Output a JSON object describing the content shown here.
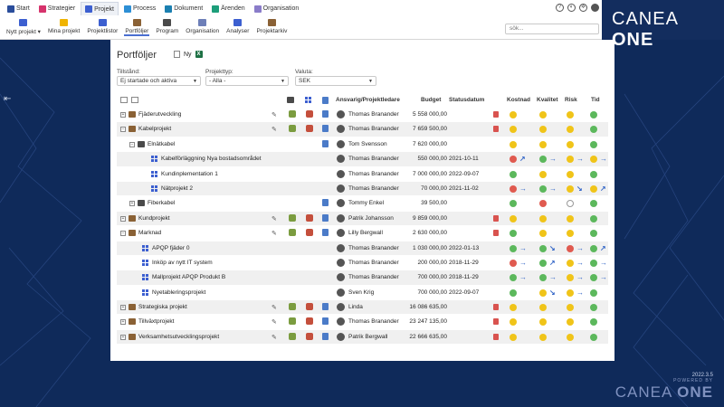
{
  "brand": {
    "name_a": "CANEA",
    "name_b": "ONE"
  },
  "modules": [
    {
      "label": "Start",
      "color": "#2a4d9b",
      "icon": "home-icon",
      "active": false
    },
    {
      "label": "Strategier",
      "color": "#d6336c",
      "icon": "strategy-icon",
      "active": false
    },
    {
      "label": "Projekt",
      "color": "#3c5fd0",
      "icon": "project-icon",
      "active": true
    },
    {
      "label": "Process",
      "color": "#2d8fd5",
      "icon": "process-icon",
      "active": false
    },
    {
      "label": "Dokument",
      "color": "#1b7fb0",
      "icon": "document-icon",
      "active": false
    },
    {
      "label": "Ärenden",
      "color": "#1d9e7a",
      "icon": "case-icon",
      "active": false
    },
    {
      "label": "Organisation",
      "color": "#8a7cc9",
      "icon": "organisation-icon",
      "active": false
    }
  ],
  "subnav": [
    {
      "label": "Nytt projekt ▾",
      "color": "#3c5fd0",
      "icon": "grid-icon"
    },
    {
      "label": "Mina projekt",
      "color": "#f0b400",
      "icon": "star-icon"
    },
    {
      "label": "Projektlistor",
      "color": "#3c5fd0",
      "icon": "list-icon"
    },
    {
      "label": "Portföljer",
      "color": "#8a6135",
      "icon": "portfolio-icon",
      "active": true
    },
    {
      "label": "Program",
      "color": "#4a4a4a",
      "icon": "program-icon"
    },
    {
      "label": "Organisation",
      "color": "#6d7fb8",
      "icon": "organisation-icon"
    },
    {
      "label": "Analyser",
      "color": "#3c5fd0",
      "icon": "chart-icon"
    },
    {
      "label": "Projektarkiv",
      "color": "#8a6135",
      "icon": "archive-icon"
    }
  ],
  "search": {
    "placeholder": "sök..."
  },
  "panel": {
    "title": "Portföljer",
    "new_label": "Ny",
    "filters": [
      {
        "label": "Tillstånd:",
        "value": "Ej startade och aktiva"
      },
      {
        "label": "Projekttyp:",
        "value": "- Alla -"
      },
      {
        "label": "Valuta:",
        "value": "SEK"
      }
    ],
    "columns": {
      "responsible": "Ansvarig/Projektledare",
      "budget": "Budget",
      "status_date": "Statusdatum",
      "cost": "Kostnad",
      "quality": "Kvalitet",
      "risk": "Risk",
      "time": "Tid"
    },
    "rows": [
      {
        "level": 0,
        "kind": "portfolio",
        "exp": "+",
        "name": "Fjäderutveckling",
        "pen": true,
        "puz": true,
        "book": true,
        "resp": "Thomas Branander",
        "budget": "5 558 000,00",
        "date": "",
        "trash": true,
        "s": [
          "y",
          "y",
          "y",
          "g"
        ],
        "a": [
          "",
          "",
          "",
          ""
        ]
      },
      {
        "level": 0,
        "kind": "portfolio",
        "exp": "−",
        "name": "Kabelprojekt",
        "pen": true,
        "puz": true,
        "book": true,
        "resp": "Thomas Branander",
        "budget": "7 659 500,00",
        "date": "",
        "trash": true,
        "s": [
          "y",
          "y",
          "y",
          "g"
        ],
        "a": [
          "",
          "",
          "",
          ""
        ]
      },
      {
        "level": 1,
        "kind": "program",
        "exp": "−",
        "name": "Elnätkabel",
        "pen": false,
        "puz": false,
        "book": true,
        "resp": "Tom Svensson",
        "budget": "7 620 000,00",
        "date": "",
        "trash": false,
        "s": [
          "y",
          "y",
          "y",
          "g"
        ],
        "a": [
          "",
          "",
          "",
          ""
        ]
      },
      {
        "level": 2,
        "kind": "project",
        "exp": "",
        "name": "Kabelförläggning Nya bostadsområdet",
        "pen": false,
        "puz": false,
        "book": false,
        "resp": "Thomas Branander",
        "budget": "550 000,00",
        "date": "2021-10-11",
        "trash": false,
        "s": [
          "r",
          "g",
          "y",
          "y"
        ],
        "a": [
          "↗",
          "→",
          "→",
          "→"
        ]
      },
      {
        "level": 2,
        "kind": "project",
        "exp": "",
        "name": "Kundinplementation 1",
        "pen": false,
        "puz": false,
        "book": false,
        "resp": "Thomas Branander",
        "budget": "7 000 000,00",
        "date": "2022-09-07",
        "trash": false,
        "s": [
          "g",
          "y",
          "y",
          "g"
        ],
        "a": [
          "",
          "",
          "",
          ""
        ]
      },
      {
        "level": 2,
        "kind": "project",
        "exp": "",
        "name": "Nätprojekt 2",
        "pen": false,
        "puz": false,
        "book": false,
        "resp": "Thomas Branander",
        "budget": "70 000,00",
        "date": "2021-11-02",
        "trash": false,
        "s": [
          "r",
          "g",
          "y",
          "y"
        ],
        "a": [
          "→",
          "→",
          "↘",
          "↗"
        ]
      },
      {
        "level": 1,
        "kind": "program",
        "exp": "+",
        "name": "Fiberkabel",
        "pen": false,
        "puz": false,
        "book": true,
        "resp": "Tommy Enkel",
        "budget": "39 500,00",
        "date": "",
        "trash": false,
        "s": [
          "g",
          "r",
          "e",
          "g"
        ],
        "a": [
          "",
          "",
          "",
          ""
        ]
      },
      {
        "level": 0,
        "kind": "portfolio",
        "exp": "+",
        "name": "Kundprojekt",
        "pen": true,
        "puz": true,
        "book": true,
        "resp": "Patrik Johansson",
        "budget": "9 859 000,00",
        "date": "",
        "trash": true,
        "s": [
          "y",
          "y",
          "y",
          "g"
        ],
        "a": [
          "",
          "",
          "",
          ""
        ]
      },
      {
        "level": 0,
        "kind": "portfolio",
        "exp": "−",
        "name": "Marknad",
        "pen": true,
        "puz": true,
        "book": true,
        "resp": "Lilly Bergwall",
        "budget": "2 630 000,00",
        "date": "",
        "trash": true,
        "s": [
          "g",
          "y",
          "y",
          "g"
        ],
        "a": [
          "",
          "",
          "",
          ""
        ]
      },
      {
        "level": 1,
        "kind": "project",
        "exp": "",
        "name": "APQP fjäder 0",
        "pen": false,
        "puz": false,
        "book": false,
        "resp": "Thomas Branander",
        "budget": "1 030 000,00",
        "date": "2022-01-13",
        "trash": false,
        "s": [
          "g",
          "g",
          "r",
          "g"
        ],
        "a": [
          "→",
          "↘",
          "→",
          "↗"
        ]
      },
      {
        "level": 1,
        "kind": "project",
        "exp": "",
        "name": "Inköp av nytt IT system",
        "pen": false,
        "puz": false,
        "book": false,
        "resp": "Thomas Branander",
        "budget": "200 000,00",
        "date": "2018-11-29",
        "trash": false,
        "s": [
          "r",
          "g",
          "y",
          "g"
        ],
        "a": [
          "→",
          "↗",
          "→",
          "→"
        ]
      },
      {
        "level": 1,
        "kind": "project",
        "exp": "",
        "name": "Mallprojekt APQP Produkt B",
        "pen": false,
        "puz": false,
        "book": false,
        "resp": "Thomas Branander",
        "budget": "700 000,00",
        "date": "2018-11-29",
        "trash": false,
        "s": [
          "g",
          "g",
          "y",
          "g"
        ],
        "a": [
          "→",
          "→",
          "→",
          "→"
        ]
      },
      {
        "level": 1,
        "kind": "project",
        "exp": "",
        "name": "Nyetableringsprojekt",
        "pen": false,
        "puz": false,
        "book": false,
        "resp": "Sven Krig",
        "budget": "700 000,00",
        "date": "2022-09-07",
        "trash": false,
        "s": [
          "g",
          "y",
          "y",
          "g"
        ],
        "a": [
          "",
          "↘",
          "→",
          ""
        ]
      },
      {
        "level": 0,
        "kind": "portfolio",
        "exp": "+",
        "name": "Strategiska projekt",
        "pen": true,
        "puz": true,
        "book": true,
        "resp": "Linda",
        "budget": "16 086 635,00",
        "date": "",
        "trash": true,
        "s": [
          "y",
          "y",
          "y",
          "g"
        ],
        "a": [
          "",
          "",
          "",
          ""
        ]
      },
      {
        "level": 0,
        "kind": "portfolio",
        "exp": "+",
        "name": "Tillväxtprojekt",
        "pen": true,
        "puz": true,
        "book": true,
        "resp": "Thomas Branander",
        "budget": "23 247 135,00",
        "date": "",
        "trash": true,
        "s": [
          "y",
          "y",
          "y",
          "g"
        ],
        "a": [
          "",
          "",
          "",
          ""
        ]
      },
      {
        "level": 0,
        "kind": "portfolio",
        "exp": "+",
        "name": "Verksamhetsutvecklingsprojekt",
        "pen": true,
        "puz": true,
        "book": true,
        "resp": "Patrik Bergwall",
        "budget": "22 666 635,00",
        "date": "",
        "trash": true,
        "s": [
          "y",
          "y",
          "y",
          "g"
        ],
        "a": [
          "",
          "",
          "",
          ""
        ]
      }
    ]
  },
  "footer": {
    "version": "2022.3.5",
    "powered_by": "POWERED BY",
    "logo_a": "CANEA",
    "logo_b": "ONE"
  }
}
